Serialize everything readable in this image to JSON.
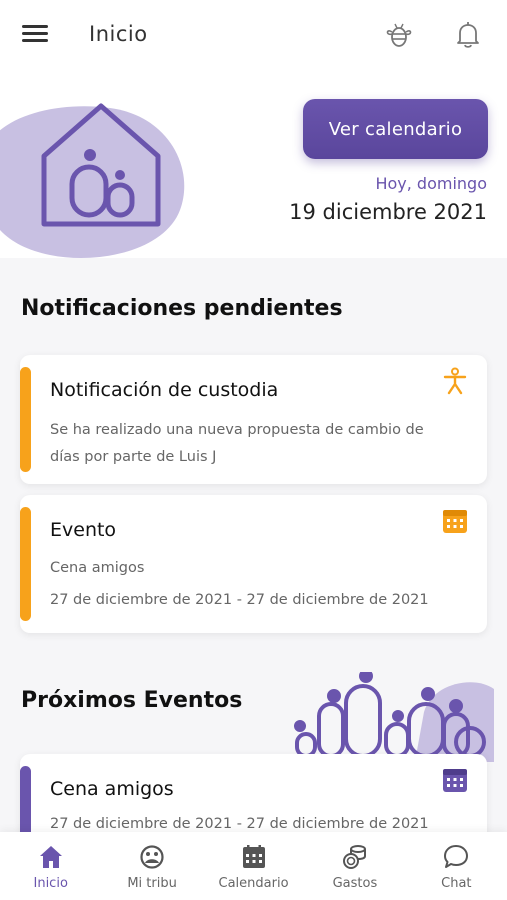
{
  "header": {
    "title": "Inicio"
  },
  "hero": {
    "calendar_button": "Ver calendario",
    "today_label": "Hoy, domingo",
    "today_date": "19 diciembre 2021"
  },
  "pending": {
    "title": "Notificaciones pendientes",
    "cards": [
      {
        "title": "Notificación de custodia",
        "line1": "Se ha realizado una nueva propuesta de cambio de",
        "line2": "días por parte de Luis J",
        "icon": "person-icon",
        "accent": "#f7a21b"
      },
      {
        "title": "Evento",
        "line1": "Cena amigos",
        "line2": "27 de diciembre de 2021 - 27 de diciembre de 2021",
        "icon": "calendar-icon",
        "accent": "#f7a21b"
      }
    ]
  },
  "upcoming": {
    "title": "Próximos Eventos",
    "cards": [
      {
        "title": "Cena amigos",
        "line1": "27 de diciembre de 2021 - 27 de diciembre de 2021",
        "icon": "calendar-icon",
        "accent": "#6a55ad"
      }
    ]
  },
  "nav": [
    {
      "label": "Inicio",
      "icon": "home-icon",
      "active": true
    },
    {
      "label": "Mi tribu",
      "icon": "tribe-icon"
    },
    {
      "label": "Calendario",
      "icon": "calendar-icon"
    },
    {
      "label": "Gastos",
      "icon": "coins-icon"
    },
    {
      "label": "Chat",
      "icon": "chat-icon"
    }
  ],
  "colors": {
    "primary": "#6a55ad",
    "accent": "#f7a21b",
    "blob": "#c8c0e2"
  }
}
